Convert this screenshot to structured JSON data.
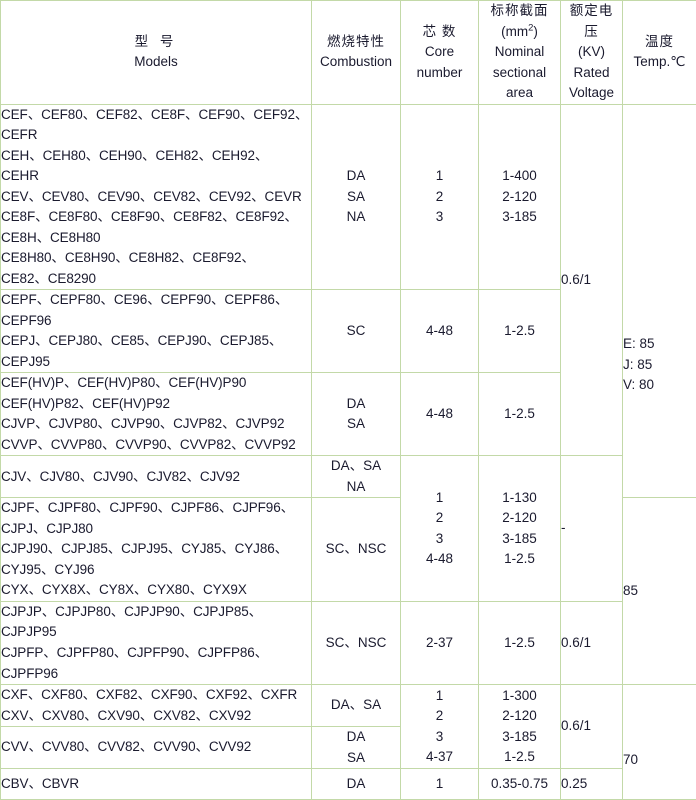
{
  "table": {
    "headers": {
      "models": {
        "cn": "型 号",
        "en": "Models"
      },
      "combustion": {
        "cn": "燃烧特性",
        "en": "Combustion"
      },
      "core": {
        "cn": "芯 数",
        "en_1": "Core",
        "en_2": "number"
      },
      "area": {
        "cn": "标称截面",
        "unit_pre": "(mm",
        "unit_sup": "2",
        "unit_post": ")",
        "en_1": "Nominal",
        "en_2": "sectional",
        "en_3": "area"
      },
      "voltage": {
        "cn_1": "额定电",
        "cn_2": "压",
        "unit": "(KV)",
        "en_1": "Rated",
        "en_2": "Voltage"
      },
      "temp": {
        "cn": "温度",
        "en": "Temp.℃"
      }
    },
    "rows": [
      {
        "models": "CEF、CEF80、CEF82、CE8F、CEF90、CEF92、\nCEFR\nCEH、CEH80、CEH90、CEH82、CEH92、\nCEHR\nCEV、CEV80、CEV90、CEV82、CEV92、CEVR\nCE8F、CE8F80、CE8F90、CE8F82、CE8F92、\nCE8H、CE8H80\nCE8H80、CE8H90、CE8H82、CE8F92、\nCE82、CE8290",
        "combustion": "DA\nSA\nNA",
        "core": "1\n2\n3",
        "area": "1-400\n2-120\n3-185"
      },
      {
        "models": "CEPF、CEPF80、CE96、CEPF90、CEPF86、\nCEPF96\nCEPJ、CEPJ80、CE85、CEPJ90、CEPJ85、\nCEPJ95",
        "combustion": "SC",
        "core": "4-48",
        "area": "1-2.5"
      },
      {
        "models": "CEF(HV)P、CEF(HV)P80、CEF(HV)P90\nCEF(HV)P82、CEF(HV)P92\nCJVP、CJVP80、CJVP90、CJVP82、CJVP92\nCVVP、CVVP80、CVVP90、CVVP82、CVVP92",
        "combustion": "DA\nSA",
        "core": "4-48",
        "area": "1-2.5"
      },
      {
        "models": "CJV、CJV80、CJV90、CJV82、CJV92",
        "combustion": "DA、SA\nNA"
      },
      {
        "models": "CJPF、CJPF80、CJPF90、CJPF86、CJPF96、\nCJPJ、CJPJ80\nCJPJ90、CJPJ85、CJPJ95、CYJ85、CYJ86、\nCYJ95、CYJ96\nCYX、CYX8X、CY8X、CYX80、CYX9X",
        "combustion": "SC、NSC"
      },
      {
        "models": "CJPJP、CJPJP80、CJPJP90、CJPJP85、\nCJPJP95\nCJPFP、CJPFP80、CJPFP90、CJPFP86、\nCJPFP96",
        "combustion": "SC、NSC",
        "core": "2-37",
        "area": "1-2.5",
        "voltage": "0.6/1"
      },
      {
        "models": "CXF、CXF80、CXF82、CXF90、CXF92、CXFR\nCXV、CXV80、CXV90、CXV82、CXV92",
        "combustion": "DA、SA"
      },
      {
        "models": "CVV、CVV80、CVV82、CVV90、CVV92",
        "combustion": "DA\nSA"
      },
      {
        "models": "CBV、CBVR",
        "combustion": "DA"
      }
    ],
    "merged": {
      "core_group_1": "1\n2\n3\n4-48",
      "area_group_1": "1-130\n2-120\n3-185\n1-2.5",
      "voltage_dash": "-",
      "core_group_2": "1\n2\n3\n4-37",
      "area_group_2": "1-300\n2-120\n3-185\n1-2.5",
      "voltage_group_2": "0.6/1",
      "voltage_top": "0.6/1",
      "core_last": "1",
      "area_last": "0.35-0.75",
      "voltage_last": "0.25",
      "temp_top": "E: 85\nJ: 85\nV: 80",
      "temp_mid": "85",
      "temp_bottom": "70"
    }
  },
  "colors": {
    "border": "#c3d9a8",
    "text": "#1a1a2e",
    "background": "#ffffff"
  }
}
